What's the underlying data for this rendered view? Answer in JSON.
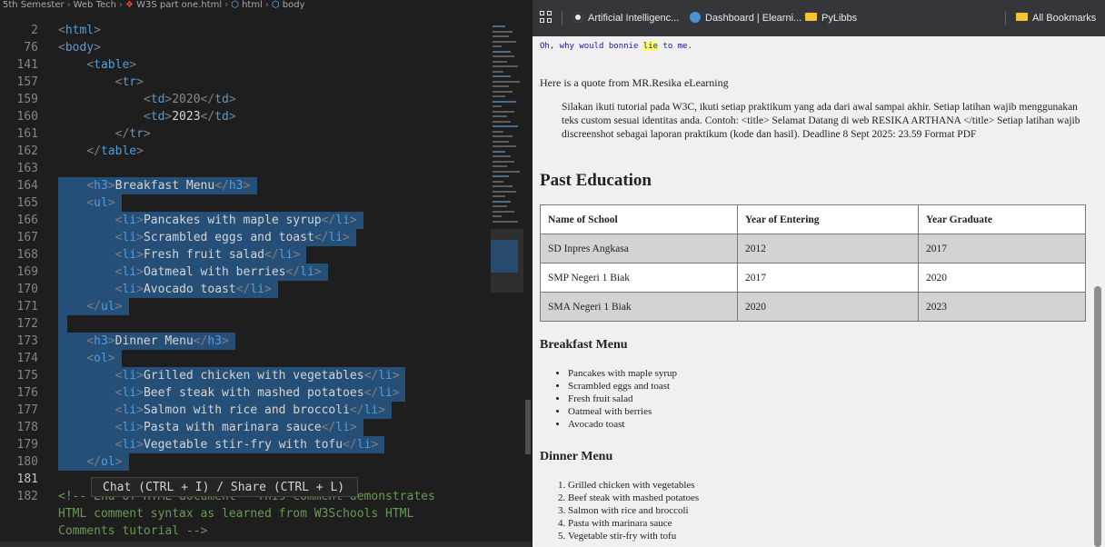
{
  "editor": {
    "breadcrumb": [
      "5th Semester",
      "Web Tech",
      "W3S part one.html",
      "html",
      "body"
    ],
    "chat_hint": "Chat (CTRL + I) / Share (CTRL + L)",
    "lines": [
      {
        "n": "2",
        "code": "<html>"
      },
      {
        "n": "76",
        "code": "<body>"
      },
      {
        "n": "141",
        "code": "    <table>"
      },
      {
        "n": "157",
        "code": "        <tr>"
      },
      {
        "n": "159",
        "code": "            <td>2020</td>"
      },
      {
        "n": "160",
        "code": "            <td>2023</td>"
      },
      {
        "n": "161",
        "code": "        </tr>"
      },
      {
        "n": "162",
        "code": "    </table>"
      },
      {
        "n": "163",
        "code": ""
      },
      {
        "n": "164",
        "code": "    <h3>Breakfast Menu</h3>"
      },
      {
        "n": "165",
        "code": "    <ul>"
      },
      {
        "n": "166",
        "code": "        <li>Pancakes with maple syrup</li>"
      },
      {
        "n": "167",
        "code": "        <li>Scrambled eggs and toast</li>"
      },
      {
        "n": "168",
        "code": "        <li>Fresh fruit salad</li>"
      },
      {
        "n": "169",
        "code": "        <li>Oatmeal with berries</li>"
      },
      {
        "n": "170",
        "code": "        <li>Avocado toast</li>"
      },
      {
        "n": "171",
        "code": "    </ul>"
      },
      {
        "n": "172",
        "code": ""
      },
      {
        "n": "173",
        "code": "    <h3>Dinner Menu</h3>"
      },
      {
        "n": "174",
        "code": "    <ol>"
      },
      {
        "n": "175",
        "code": "        <li>Grilled chicken with vegetables</li>"
      },
      {
        "n": "176",
        "code": "        <li>Beef steak with mashed potatoes</li>"
      },
      {
        "n": "177",
        "code": "        <li>Salmon with rice and broccoli</li>"
      },
      {
        "n": "178",
        "code": "        <li>Pasta with marinara sauce</li>"
      },
      {
        "n": "179",
        "code": "        <li>Vegetable stir-fry with tofu</li>"
      },
      {
        "n": "180",
        "code": "    </ol>"
      },
      {
        "n": "181",
        "code": ""
      },
      {
        "n": "182",
        "code": "<!-- End of HTML document - This comment demonstrates"
      },
      {
        "n": "",
        "code": "HTML comment syntax as learned from W3Schools HTML"
      },
      {
        "n": "",
        "code": "Comments tutorial -->"
      }
    ]
  },
  "browser": {
    "bookmarks": [
      {
        "label": "Artificial Intelligenc...",
        "icon": "openai-icon"
      },
      {
        "label": "Dashboard | Elearni...",
        "icon": "elearning-icon"
      },
      {
        "label": "PyLibbs",
        "icon": "folder-icon"
      }
    ],
    "all_bookmarks": "All Bookmarks",
    "page": {
      "lyric_before": "Oh, why would bonnie ",
      "lyric_highlight": "lie",
      "lyric_after": " to me.",
      "quote_intro": "Here is a quote from MR.Resika eLearning",
      "quote": "Silakan ikuti tutorial pada W3C, ikuti setiap praktikum yang ada dari awal sampai akhir. Setiap latihan wajib menggunakan teks custom sesuai identitas anda. Contoh: <title> Selamat Datang di web RESIKA ARTHANA </title> Setiap latihan wajib discreenshot sebagai laporan praktikum (kode dan hasil). Deadline 8 Sept 2025: 23.59 Format PDF",
      "education_title": "Past Education",
      "table": {
        "headers": [
          "Name of School",
          "Year of Entering",
          "Year Graduate"
        ],
        "rows": [
          [
            "SD Inpres Angkasa",
            "2012",
            "2017"
          ],
          [
            "SMP Negeri 1 Biak",
            "2017",
            "2020"
          ],
          [
            "SMA Negeri 1 Biak",
            "2020",
            "2023"
          ]
        ]
      },
      "breakfast_title": "Breakfast Menu",
      "breakfast_items": [
        "Pancakes with maple syrup",
        "Scrambled eggs and toast",
        "Fresh fruit salad",
        "Oatmeal with berries",
        "Avocado toast"
      ],
      "dinner_title": "Dinner Menu",
      "dinner_items": [
        "Grilled chicken with vegetables",
        "Beef steak with mashed potatoes",
        "Salmon with rice and broccoli",
        "Pasta with marinara sauce",
        "Vegetable stir-fry with tofu"
      ]
    }
  },
  "colors": {
    "editor_bg": "#1e1e1e",
    "selection": "#264f78",
    "tag": "#569cd6",
    "comment": "#6a9955",
    "row_shade": "#d3d3d3"
  }
}
